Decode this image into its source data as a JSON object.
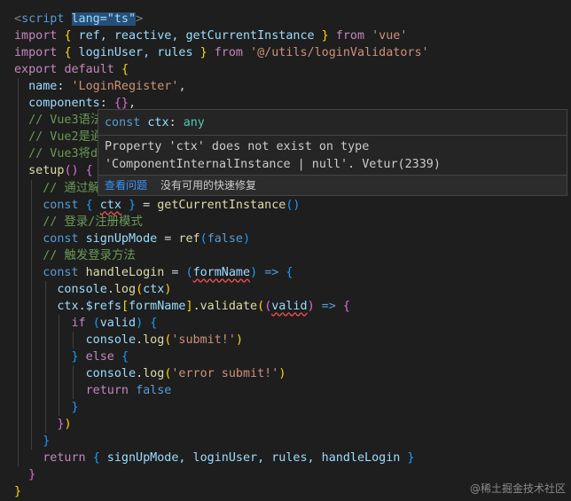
{
  "colors": {
    "keyword": "#569cd6",
    "control": "#c586c0",
    "variable": "#9cdcfe",
    "function": "#dcdcaa",
    "string": "#ce9178",
    "comment": "#6a9955",
    "punct": "#d4d4d4",
    "tag": "#808080",
    "bracket1": "#ffd700",
    "bracket2": "#da70d6",
    "bracket3": "#179fff",
    "error": "#f14c4c",
    "link": "#3794ff"
  },
  "lines": [
    [
      [
        "<",
        "tag"
      ],
      [
        "script",
        "keyword"
      ],
      [
        " ",
        "punct"
      ],
      [
        "lang=\"ts\"",
        "variable_sel"
      ],
      [
        ">",
        "tag"
      ]
    ],
    [
      [
        "import",
        "control"
      ],
      [
        " ",
        "punct"
      ],
      [
        "{",
        "bracket1"
      ],
      [
        " ref, reactive, getCurrentInstance ",
        "variable"
      ],
      [
        "}",
        "bracket1"
      ],
      [
        " from ",
        "control"
      ],
      [
        "'vue'",
        "string"
      ]
    ],
    [
      [
        "import",
        "control"
      ],
      [
        " ",
        "punct"
      ],
      [
        "{",
        "bracket1"
      ],
      [
        " loginUser, rules ",
        "variable"
      ],
      [
        "}",
        "bracket1"
      ],
      [
        " from ",
        "control"
      ],
      [
        "'@/utils/loginValidators'",
        "string"
      ]
    ],
    [
      [
        "export",
        "control"
      ],
      [
        " ",
        "punct"
      ],
      [
        "default",
        "control"
      ],
      [
        " ",
        "punct"
      ],
      [
        "{",
        "bracket1"
      ]
    ],
    [
      [
        "  name",
        "variable"
      ],
      [
        ": ",
        "punct"
      ],
      [
        "'LoginRegister'",
        "string"
      ],
      [
        ",",
        "punct"
      ]
    ],
    [
      [
        "  components",
        "variable"
      ],
      [
        ": ",
        "punct"
      ],
      [
        "{}",
        "bracket2"
      ],
      [
        ",",
        "punct"
      ]
    ],
    [
      [
        "  // Vue3语法",
        "comment"
      ]
    ],
    [
      [
        "  // Vue2是通",
        "comment"
      ]
    ],
    [
      [
        "  // Vue3将d",
        "comment"
      ]
    ],
    [
      [
        "  setup",
        "function"
      ],
      [
        "() ",
        "bracket2"
      ],
      [
        "{",
        "bracket2"
      ]
    ],
    [
      [
        "    // 通过解",
        "comment"
      ]
    ],
    [
      [
        "    const",
        "keyword"
      ],
      [
        " ",
        "punct"
      ],
      [
        "{",
        "bracket3"
      ],
      [
        " ",
        "punct"
      ],
      [
        "ctx",
        "variable_err"
      ],
      [
        " ",
        "punct"
      ],
      [
        "}",
        "bracket3"
      ],
      [
        " = ",
        "punct"
      ],
      [
        "getCurrentInstance",
        "function"
      ],
      [
        "()",
        "bracket3"
      ]
    ],
    [
      [
        "    // 登录/注册模式",
        "comment"
      ]
    ],
    [
      [
        "    const",
        "keyword"
      ],
      [
        " ",
        "punct"
      ],
      [
        "signUpMode",
        "variable"
      ],
      [
        " = ",
        "punct"
      ],
      [
        "ref",
        "function"
      ],
      [
        "(",
        "bracket3"
      ],
      [
        "false",
        "keyword"
      ],
      [
        ")",
        "bracket3"
      ]
    ],
    [
      [
        "    // 触发登录方法",
        "comment"
      ]
    ],
    [
      [
        "    const",
        "keyword"
      ],
      [
        " ",
        "punct"
      ],
      [
        "handleLogin",
        "function"
      ],
      [
        " = ",
        "punct"
      ],
      [
        "(",
        "bracket3"
      ],
      [
        "formName",
        "variable_err"
      ],
      [
        ")",
        "bracket3"
      ],
      [
        " ",
        "punct"
      ],
      [
        "=>",
        "keyword"
      ],
      [
        " ",
        "punct"
      ],
      [
        "{",
        "bracket3"
      ]
    ],
    [
      [
        "      console",
        "variable"
      ],
      [
        ".",
        "punct"
      ],
      [
        "log",
        "function"
      ],
      [
        "(",
        "bracket1"
      ],
      [
        "ctx",
        "variable"
      ],
      [
        ")",
        "bracket1"
      ]
    ],
    [
      [
        "      ctx",
        "variable"
      ],
      [
        ".",
        "punct"
      ],
      [
        "$refs",
        "variable"
      ],
      [
        "[",
        "bracket1"
      ],
      [
        "formName",
        "variable"
      ],
      [
        "]",
        "bracket1"
      ],
      [
        ".",
        "punct"
      ],
      [
        "validate",
        "function"
      ],
      [
        "(",
        "bracket1"
      ],
      [
        "(",
        "bracket2"
      ],
      [
        "valid",
        "variable_err"
      ],
      [
        ")",
        "bracket2"
      ],
      [
        " ",
        "punct"
      ],
      [
        "=>",
        "keyword"
      ],
      [
        " ",
        "punct"
      ],
      [
        "{",
        "bracket2"
      ]
    ],
    [
      [
        "        if",
        "control"
      ],
      [
        " ",
        "punct"
      ],
      [
        "(",
        "bracket3"
      ],
      [
        "valid",
        "variable"
      ],
      [
        ")",
        "bracket3"
      ],
      [
        " ",
        "punct"
      ],
      [
        "{",
        "bracket3"
      ]
    ],
    [
      [
        "          console",
        "variable"
      ],
      [
        ".",
        "punct"
      ],
      [
        "log",
        "function"
      ],
      [
        "(",
        "bracket1"
      ],
      [
        "'submit!'",
        "string"
      ],
      [
        ")",
        "bracket1"
      ]
    ],
    [
      [
        "        ",
        "punct"
      ],
      [
        "}",
        "bracket3"
      ],
      [
        " ",
        "punct"
      ],
      [
        "else",
        "control"
      ],
      [
        " ",
        "punct"
      ],
      [
        "{",
        "bracket3"
      ]
    ],
    [
      [
        "          console",
        "variable"
      ],
      [
        ".",
        "punct"
      ],
      [
        "log",
        "function"
      ],
      [
        "(",
        "bracket1"
      ],
      [
        "'error submit!'",
        "string"
      ],
      [
        ")",
        "bracket1"
      ]
    ],
    [
      [
        "          return",
        "control"
      ],
      [
        " ",
        "punct"
      ],
      [
        "false",
        "keyword"
      ]
    ],
    [
      [
        "        ",
        "punct"
      ],
      [
        "}",
        "bracket3"
      ]
    ],
    [
      [
        "      ",
        "punct"
      ],
      [
        "}",
        "bracket2"
      ],
      [
        ")",
        "bracket1"
      ]
    ],
    [
      [
        "    ",
        "punct"
      ],
      [
        "}",
        "bracket3"
      ]
    ],
    [
      [
        "    return",
        "control"
      ],
      [
        " ",
        "punct"
      ],
      [
        "{",
        "bracket3"
      ],
      [
        " signUpMode, loginUser, rules, handleLogin ",
        "variable"
      ],
      [
        "}",
        "bracket3"
      ]
    ],
    [
      [
        "  ",
        "punct"
      ],
      [
        "}",
        "bracket2"
      ]
    ],
    [
      [
        "}",
        "bracket1"
      ]
    ]
  ],
  "hover": {
    "sig_keyword": "const",
    "sig_name": "ctx",
    "sig_colon": ":",
    "sig_type": "any",
    "message": "Property 'ctx' does not exist on type 'ComponentInternalInstance | null'. Vetur(2339)",
    "view_problem": "查看问题",
    "no_fix": "没有可用的快速修复"
  },
  "watermark": "@稀土掘金技术社区"
}
